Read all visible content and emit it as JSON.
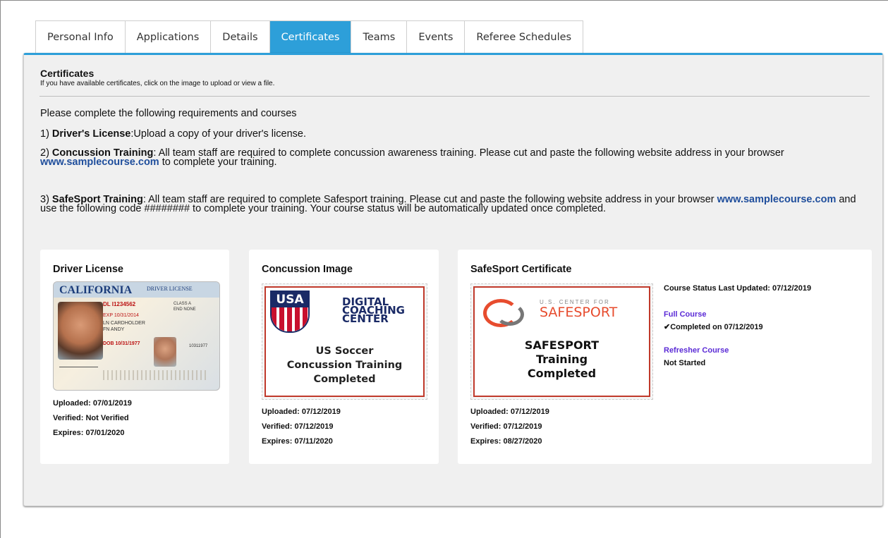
{
  "tabs": [
    {
      "label": "Personal Info",
      "active": false
    },
    {
      "label": "Applications",
      "active": false
    },
    {
      "label": "Details",
      "active": false
    },
    {
      "label": "Certificates",
      "active": true
    },
    {
      "label": "Teams",
      "active": false
    },
    {
      "label": "Events",
      "active": false
    },
    {
      "label": "Referee Schedules",
      "active": false
    }
  ],
  "colors": {
    "accent": "#2d9fd9",
    "link": "#1f4e9c",
    "purple": "#5b2bd6",
    "red": "#c0392b"
  },
  "section": {
    "title": "Certificates",
    "subtitle": "If you have available certificates, click on the image to upload or view a file."
  },
  "requirements": {
    "intro": "Please complete the following requirements and courses",
    "item1": {
      "prefix": "1) ",
      "bold": "Driver's License",
      "text": ":Upload a copy of your driver's license."
    },
    "item2": {
      "prefix": "2) ",
      "bold": "Concussion Training",
      "text_a": ": All team staff are required to complete concussion awareness training. Please cut and paste the following website address in your browser ",
      "link": "www.samplecourse.com",
      "text_b": " to complete your training."
    },
    "item3": {
      "prefix": "3) ",
      "bold": "SafeSport Training",
      "text_a": ": All team staff are required to complete Safesport training. Please cut and paste the following website address in your browser ",
      "link": "www.samplecourse.com",
      "text_b": " and use the following code ######## to complete your training. Your course status will be automatically updated once completed."
    }
  },
  "cards": {
    "driver": {
      "title": "Driver License",
      "uploaded": "Uploaded: 07/01/2019",
      "verified": "Verified: Not Verified",
      "expires": "Expires: 07/01/2020",
      "image": {
        "state": "CALIFORNIA",
        "doc": "DRIVER LICENSE",
        "dl": "DL I1234562",
        "exp": "EXP 10/31/2014",
        "name1": "LN CARDHOLDER",
        "name2": "FN ANDY",
        "dob": "DOB 10/31/1977",
        "class": "CLASS A",
        "end": "END NONE",
        "num": "10311977"
      }
    },
    "concussion": {
      "title": "Concussion Image",
      "uploaded": "Uploaded: 07/12/2019",
      "verified": "Verified: 07/12/2019",
      "expires": "Expires: 07/11/2020",
      "image": {
        "logo": "USA",
        "heading_1": "DIGITAL",
        "heading_2": "COACHING",
        "heading_3": "CENTER",
        "line_1": "US Soccer",
        "line_2": "Concussion Training",
        "line_3": "Completed"
      }
    },
    "safesport": {
      "title": "SafeSport Certificate",
      "uploaded": "Uploaded: 07/12/2019",
      "verified": "Verified: 07/12/2019",
      "expires": "Expires: 08/27/2020",
      "image": {
        "center_for": "U.S. CENTER FOR",
        "brand": "SAFESPORT",
        "line_1": "SAFESPORT",
        "line_2": "Training",
        "line_3": "Completed"
      },
      "status_updated": "Course Status Last Updated: 07/12/2019",
      "full_course_label": "Full Course",
      "full_course_status": "✔Completed on 07/12/2019",
      "refresher_label": "Refresher Course",
      "refresher_status": "Not Started"
    }
  }
}
